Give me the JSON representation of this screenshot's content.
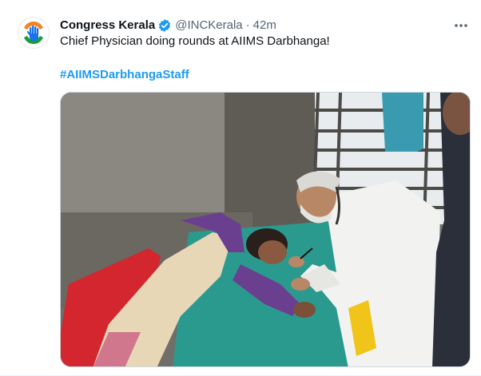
{
  "tweet": {
    "display_name": "Congress Kerala",
    "verified_icon": "verified-badge-icon",
    "handle": "@INCKerala",
    "separator": "·",
    "time": "42m",
    "text": "Chief Physician doing rounds at AIIMS Darbhanga!",
    "hashtag": "#AIIMSDarbhangaStaff",
    "more_icon": "more-options-icon",
    "avatar_icon": "congress-hand-logo",
    "media_icon": "photo"
  },
  "colors": {
    "link": "#1d9bf0",
    "secondary_text": "#536471",
    "primary_text": "#0f1419",
    "verified": "#1d9bf0"
  }
}
